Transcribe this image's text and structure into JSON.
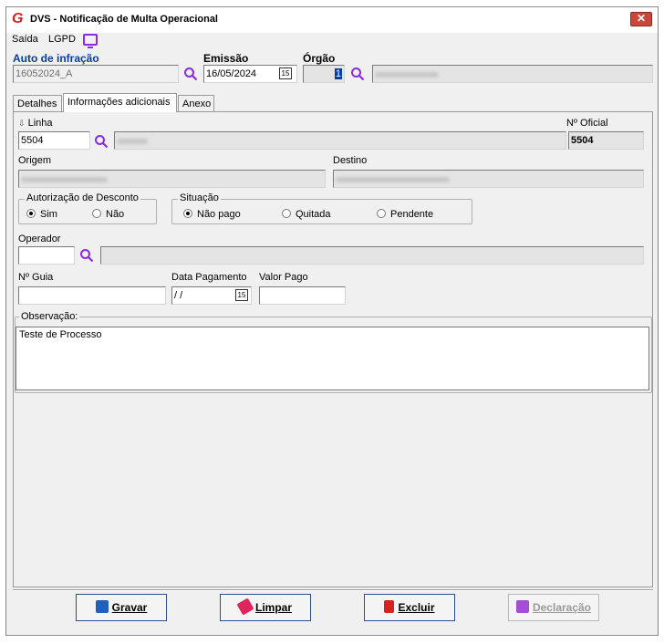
{
  "window": {
    "title": "DVS - Notificação de Multa Operacional",
    "close_label": "✕"
  },
  "menu": {
    "saida": "Saída",
    "lgpd": "LGPD"
  },
  "header": {
    "auto_label": "Auto de infração",
    "auto_value": "16052024_A",
    "emissao_label": "Emissão",
    "emissao_value": "16/05/2024",
    "orgao_label": "Órgão",
    "orgao_value": "1"
  },
  "tabs": [
    {
      "label": "Detalhes"
    },
    {
      "label": "Informações adicionais"
    },
    {
      "label": "Anexo"
    }
  ],
  "detalhes": {
    "linha_label": "Linha",
    "linha_value": "5504",
    "num_oficial_label": "Nº Oficial",
    "num_oficial_value": "5504",
    "origem_label": "Origem",
    "destino_label": "Destino",
    "autorizacao_title": "Autorização de Desconto",
    "autorizacao_options": [
      "Sim",
      "Não"
    ],
    "situacao_title": "Situação",
    "situacao_options": [
      "Não pago",
      "Quitada",
      "Pendente"
    ],
    "operador_label": "Operador",
    "guia_label": "Nº Guia",
    "data_pagamento_label": "Data Pagamento",
    "data_pagamento_value": "/ /",
    "valor_pago_label": "Valor Pago",
    "observacao_label": "Observação:",
    "observacao_value": "Teste de Processo"
  },
  "buttons": {
    "gravar": "Gravar",
    "limpar": "Limpar",
    "excluir": "Excluir",
    "declaracao": "Declaração"
  },
  "colors": {
    "accent_blue": "#0a3ca8",
    "icon_purple": "#8a2be2",
    "close_red": "#c8463a"
  },
  "icons": {
    "search": "search-icon",
    "calendar": "calendar-icon",
    "monitor": "monitor-icon"
  }
}
